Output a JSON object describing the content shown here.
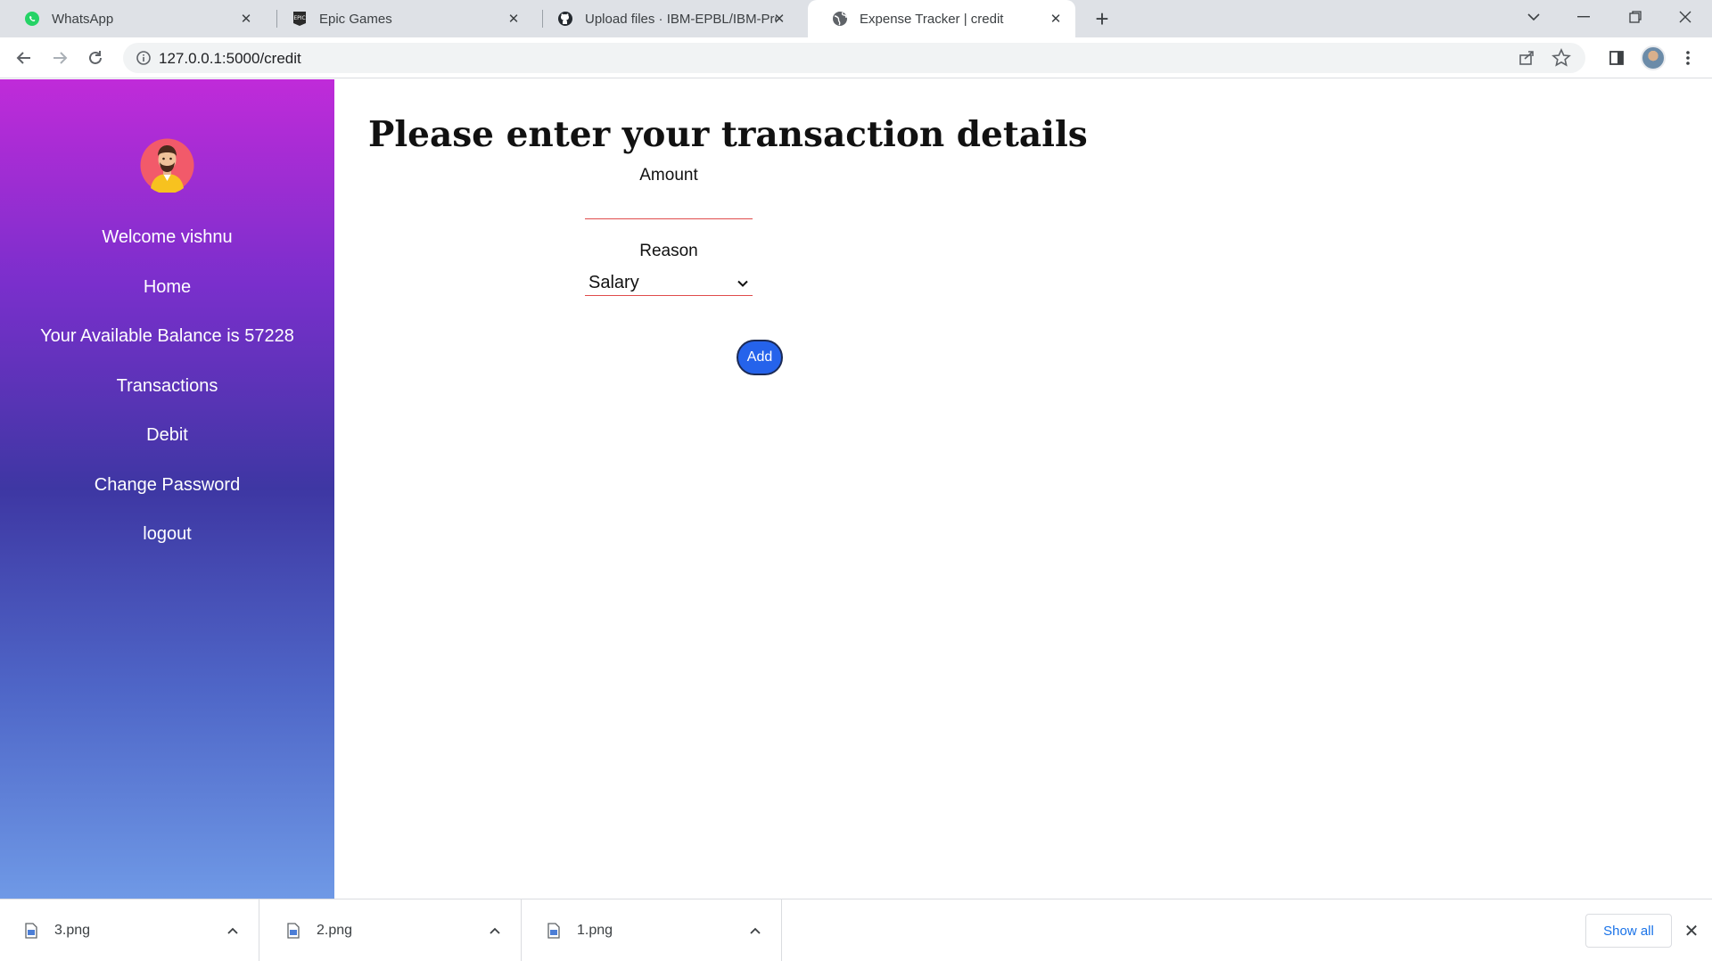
{
  "browser": {
    "tabs": [
      {
        "title": "WhatsApp",
        "icon": "whatsapp-icon"
      },
      {
        "title": "Epic Games",
        "icon": "epic-games-icon"
      },
      {
        "title": "Upload files · IBM-EPBL/IBM-Proj",
        "icon": "github-icon"
      },
      {
        "title": "Expense Tracker | credit",
        "icon": "globe-icon",
        "active": true
      }
    ],
    "new_tab": "+",
    "url": "127.0.0.1:5000/credit"
  },
  "sidebar": {
    "welcome": "Welcome vishnu",
    "items": [
      {
        "label": "Home"
      },
      {
        "label": "Your Available Balance is 57228"
      },
      {
        "label": "Transactions"
      },
      {
        "label": "Debit"
      },
      {
        "label": "Change Password"
      },
      {
        "label": "logout"
      }
    ],
    "gradient_top": "#c02bd9",
    "gradient_mid": "#3e37a3",
    "gradient_bottom": "#6f99e6"
  },
  "main": {
    "title": "Please enter your transaction details",
    "amount_label": "Amount",
    "amount_value": "",
    "reason_label": "Reason",
    "reason_selected": "Salary",
    "add_label": "Add",
    "add_color": "#2563eb"
  },
  "downloads": {
    "items": [
      {
        "name": "3.png"
      },
      {
        "name": "2.png"
      },
      {
        "name": "1.png"
      }
    ],
    "show_all": "Show all"
  }
}
